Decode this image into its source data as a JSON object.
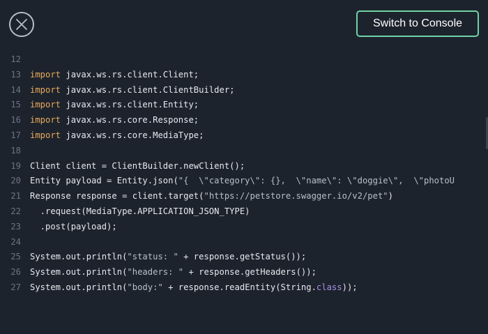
{
  "header": {
    "close_icon": "close-icon",
    "switch_button_label": "Switch to Console"
  },
  "colors": {
    "background": "#1d232d",
    "keyword": "#e8a95b",
    "string": "#b9bfc9",
    "class_keyword": "#a88fe6",
    "line_number": "#6b7482",
    "button_border": "#6fd3a6"
  },
  "code": {
    "lines": [
      {
        "n": "12",
        "tokens": []
      },
      {
        "n": "13",
        "tokens": [
          {
            "t": "import",
            "k": "kw"
          },
          {
            "t": " javax.ws.rs.client.Client;",
            "k": "id"
          }
        ]
      },
      {
        "n": "14",
        "tokens": [
          {
            "t": "import",
            "k": "kw"
          },
          {
            "t": " javax.ws.rs.client.ClientBuilder;",
            "k": "id"
          }
        ]
      },
      {
        "n": "15",
        "tokens": [
          {
            "t": "import",
            "k": "kw"
          },
          {
            "t": " javax.ws.rs.client.Entity;",
            "k": "id"
          }
        ]
      },
      {
        "n": "16",
        "tokens": [
          {
            "t": "import",
            "k": "kw"
          },
          {
            "t": " javax.ws.rs.core.Response;",
            "k": "id"
          }
        ]
      },
      {
        "n": "17",
        "tokens": [
          {
            "t": "import",
            "k": "kw"
          },
          {
            "t": " javax.ws.rs.core.MediaType;",
            "k": "id"
          }
        ]
      },
      {
        "n": "18",
        "tokens": []
      },
      {
        "n": "19",
        "tokens": [
          {
            "t": "Client client = ClientBuilder.newClient();",
            "k": "id"
          }
        ]
      },
      {
        "n": "20",
        "tokens": [
          {
            "t": "Entity payload = Entity.json(",
            "k": "id"
          },
          {
            "t": "\"{  \\\"category\\\": {},  \\\"name\\\": \\\"doggie\\\",  \\\"photoU",
            "k": "str"
          }
        ]
      },
      {
        "n": "21",
        "tokens": [
          {
            "t": "Response response = client.target(",
            "k": "id"
          },
          {
            "t": "\"https://petstore.swagger.io/v2/pet\"",
            "k": "str"
          },
          {
            "t": ")",
            "k": "id"
          }
        ]
      },
      {
        "n": "22",
        "tokens": [
          {
            "t": "  .request(MediaType.APPLICATION_JSON_TYPE)",
            "k": "id"
          }
        ]
      },
      {
        "n": "23",
        "tokens": [
          {
            "t": "  .post(payload);",
            "k": "id"
          }
        ]
      },
      {
        "n": "24",
        "tokens": []
      },
      {
        "n": "25",
        "tokens": [
          {
            "t": "System.out.println(",
            "k": "id"
          },
          {
            "t": "\"status: \"",
            "k": "str"
          },
          {
            "t": " + response.getStatus());",
            "k": "id"
          }
        ]
      },
      {
        "n": "26",
        "tokens": [
          {
            "t": "System.out.println(",
            "k": "id"
          },
          {
            "t": "\"headers: \"",
            "k": "str"
          },
          {
            "t": " + response.getHeaders());",
            "k": "id"
          }
        ]
      },
      {
        "n": "27",
        "tokens": [
          {
            "t": "System.out.println(",
            "k": "id"
          },
          {
            "t": "\"body:\"",
            "k": "str"
          },
          {
            "t": " + response.readEntity(String.",
            "k": "id"
          },
          {
            "t": "class",
            "k": "cls"
          },
          {
            "t": "));",
            "k": "id"
          }
        ]
      }
    ]
  }
}
